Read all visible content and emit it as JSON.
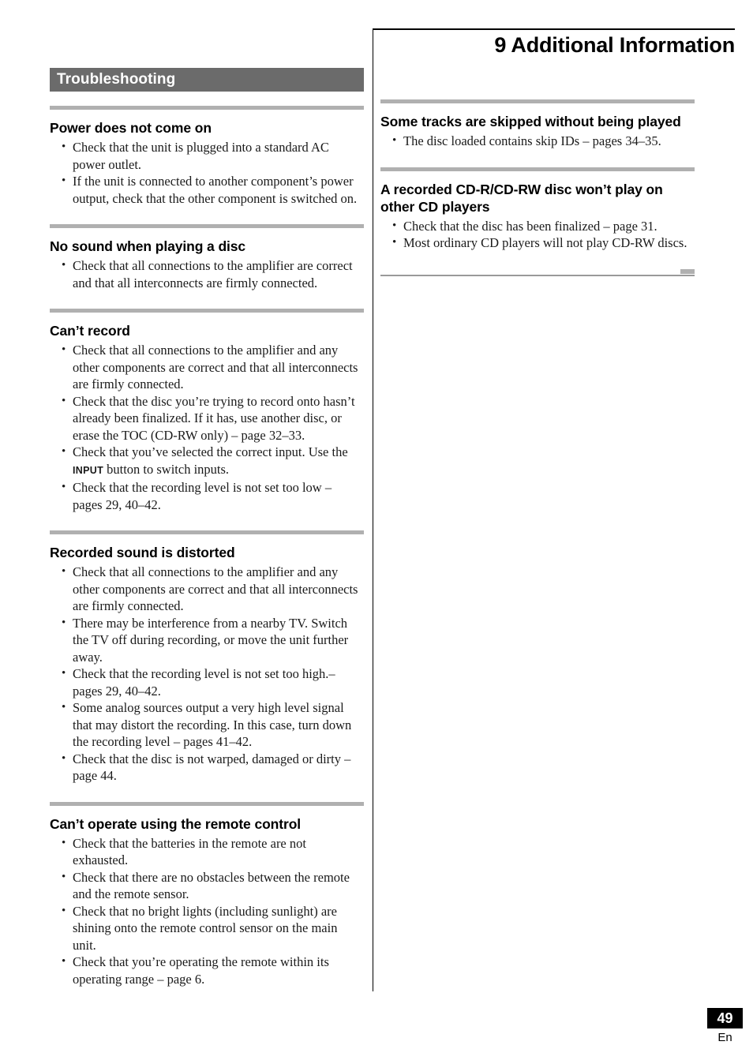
{
  "chapter": {
    "title": "9 Additional Information"
  },
  "section_banner": {
    "label": "Troubleshooting"
  },
  "footer": {
    "page_number": "49",
    "language": "En"
  },
  "left_column": {
    "sections": [
      {
        "heading": "Power does not come on",
        "items": [
          "Check that the unit is plugged into a standard AC power outlet.",
          "If the unit is connected to another component’s power output, check that the other component is switched on."
        ]
      },
      {
        "heading": "No sound when playing a disc",
        "items": [
          "Check that all connections to the amplifier are correct and that all interconnects are firmly connected."
        ]
      },
      {
        "heading": "Can’t record",
        "items": [
          "Check that all connections to the amplifier and any other components are correct and that all interconnects are firmly connected.",
          "Check that the disc you’re trying to record onto hasn’t already been finalized. If it has, use another disc, or erase the TOC (CD-RW only) – page 32–33.",
          "Check that the recording level is not set too low – pages 29, 40–42."
        ],
        "item_with_smallcaps": {
          "before": "Check that you’ve selected the correct input. Use the ",
          "smallcaps": "INPUT",
          "after": " button to switch inputs."
        }
      },
      {
        "heading": "Recorded sound is distorted",
        "items": [
          "Check that all connections to the amplifier and any other components are correct and that all interconnects are firmly connected.",
          "There may be interference from a nearby TV. Switch the TV off during recording, or move the unit further away.",
          "Check that the recording level is not set too high.– pages 29, 40–42.",
          "Some analog sources output a very high level signal that may distort the recording. In this case, turn down the recording level – pages 41–42.",
          "Check that the disc is not warped, damaged or dirty – page 44."
        ]
      },
      {
        "heading": "Can’t operate using the remote control",
        "items": [
          "Check that the batteries in the remote are not exhausted.",
          "Check that there are no obstacles between the remote and the remote sensor.",
          "Check that no bright lights (including sunlight) are shining onto the remote control sensor on the main unit.",
          "Check that you’re operating the remote within its operating range – page 6."
        ]
      }
    ]
  },
  "right_column": {
    "sections": [
      {
        "heading": "Some tracks are skipped without being played",
        "items": [
          "The disc loaded contains skip IDs – pages 34–35."
        ]
      },
      {
        "heading": "A recorded CD-R/CD-RW disc won’t play on other CD players",
        "items": [
          "Check that the disc has been finalized – page 31.",
          "Most ordinary CD players will not play CD-RW discs."
        ]
      }
    ]
  },
  "colors": {
    "banner_background": "#6b6b6b",
    "rule_gray": "#b0b0b0",
    "divider_black": "#000000",
    "page_box_background": "#000000"
  }
}
